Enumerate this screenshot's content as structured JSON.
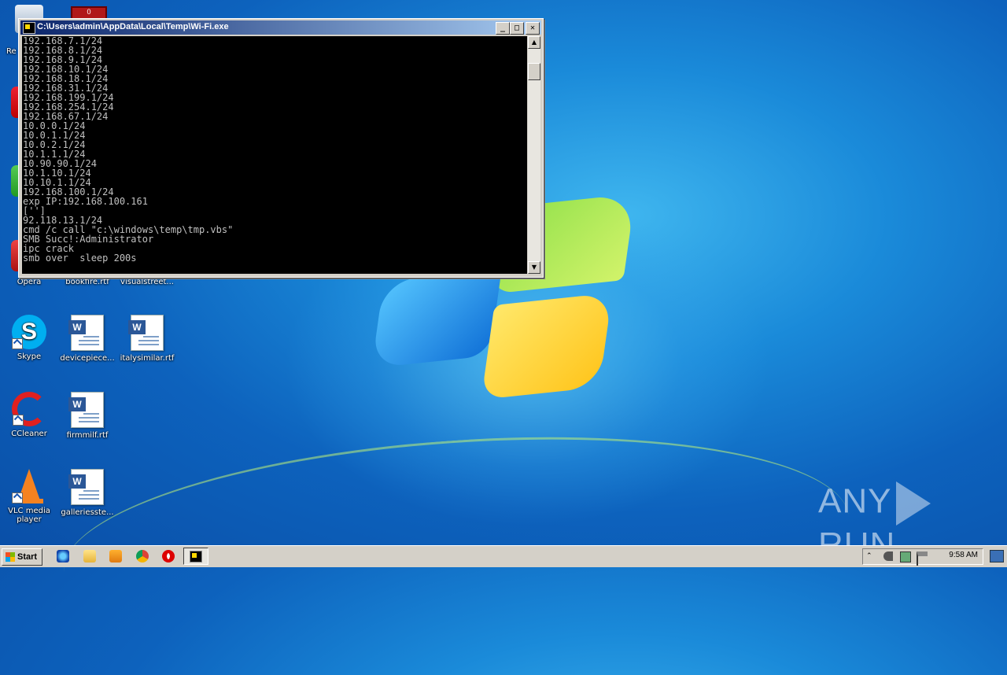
{
  "desktop": {
    "icons": [
      {
        "label": "Opera"
      },
      {
        "label": "bookfire.rtf"
      },
      {
        "label": "visualstreet..."
      },
      {
        "label": "Skype"
      },
      {
        "label": "devicepiece..."
      },
      {
        "label": "italysimilar.rtf"
      },
      {
        "label": "CCleaner"
      },
      {
        "label": "firmmilf.rtf"
      },
      {
        "label": "VLC media player"
      },
      {
        "label": "galleriesste..."
      }
    ],
    "partial_labels": {
      "recycle": "Re",
      "top_red": "0"
    }
  },
  "console_window": {
    "title": "C:\\Users\\admin\\AppData\\Local\\Temp\\Wi-Fi.exe",
    "buttons": {
      "minimize": "_",
      "maximize": "□",
      "close": "✕"
    },
    "output": "192.168.7.1/24\n192.168.8.1/24\n192.168.9.1/24\n192.168.10.1/24\n192.168.18.1/24\n192.168.31.1/24\n192.168.199.1/24\n192.168.254.1/24\n192.168.67.1/24\n10.0.0.1/24\n10.0.1.1/24\n10.0.2.1/24\n10.1.1.1/24\n10.90.90.1/24\n10.1.10.1/24\n10.10.1.1/24\n192.168.100.1/24\nexp IP:192.168.100.161\n['']\n92.118.13.1/24\ncmd /c call \"c:\\windows\\temp\\tmp.vbs\"\nSMB Succ!:Administrator\nipc crack\nsmb over  sleep 200s"
  },
  "taskbar": {
    "start_label": "Start",
    "clock": "9:58 AM",
    "quicklaunch": [
      "ie-icon",
      "explorer-icon",
      "media-player-icon",
      "chrome-icon",
      "opera-icon"
    ]
  },
  "watermark": {
    "left": "ANY",
    "right": "RUN"
  },
  "colors": {
    "console_bg": "#000000",
    "console_fg": "#c0c0c0",
    "title_active": "#0a246a",
    "desktop": "#0d62bd"
  }
}
